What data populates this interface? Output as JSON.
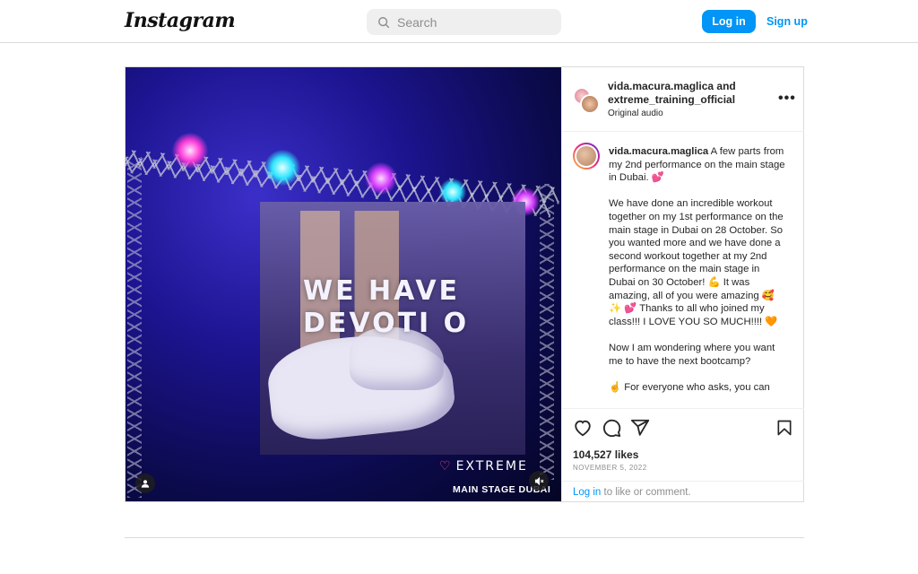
{
  "app": {
    "logo": "Instagram"
  },
  "search": {
    "placeholder": "Search"
  },
  "auth": {
    "login_label": "Log in",
    "signup_label": "Sign up"
  },
  "post": {
    "header": {
      "author_line1": "vida.macura.maglica and",
      "author_line2": "extreme_training_official",
      "audio": "Original audio"
    },
    "media": {
      "overlay_line1": "WE HAVE",
      "overlay_line2": "DEVOTI O",
      "brand": "EXTREME",
      "stage_text": "MAIN STAGE DUBAI"
    },
    "caption": {
      "username": "vida.macura.maglica",
      "text": " A few parts from my 2nd performance on the main stage in Dubai. 💕\n\nWe have done an incredible workout together on my 1st performance on the main stage in Dubai on 28 October. So you wanted more and we have done a second workout together at my 2nd performance on the main stage in Dubai on 30 October! 💪 It was amazing, all of you were amazing 🥰 ✨ 💕 Thanks to all who joined my class!!! I LOVE YOU SO MUCH!!!! 🧡\n\nNow I am wondering where you want me to have the next bootcamp?\n\n☝️ For everyone who asks, you can"
    },
    "likes": "104,527 likes",
    "date": "NOVEMBER 5, 2022",
    "login_prompt": {
      "link": "Log in",
      "rest": " to like or comment."
    }
  },
  "colors": {
    "accent": "#0095f6",
    "border": "#dbdbdb",
    "text": "#262626",
    "muted": "#8e8e8e"
  },
  "icons": [
    "search-icon",
    "more-options-icon",
    "heart-icon",
    "comment-icon",
    "share-icon",
    "bookmark-icon",
    "user-tag-icon",
    "mute-icon"
  ]
}
